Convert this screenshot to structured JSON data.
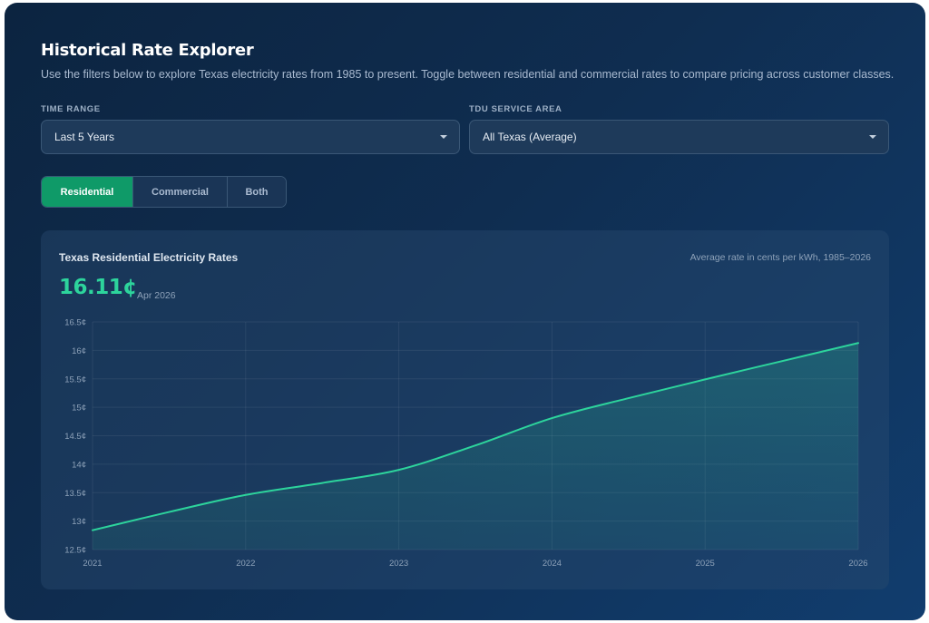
{
  "header": {
    "title": "Historical Rate Explorer",
    "description": "Use the filters below to explore Texas electricity rates from 1985 to present. Toggle between residential and commercial rates to compare pricing across customer classes."
  },
  "filters": {
    "time_range": {
      "label": "TIME RANGE",
      "value": "Last 5 Years"
    },
    "tdu_area": {
      "label": "TDU SERVICE AREA",
      "value": "All Texas (Average)"
    }
  },
  "toggles": [
    {
      "label": "Residential",
      "active": true
    },
    {
      "label": "Commercial",
      "active": false
    },
    {
      "label": "Both",
      "active": false
    }
  ],
  "chart": {
    "title": "Texas Residential Electricity Rates",
    "subtitle": "Average rate in cents per kWh, 1985–2026",
    "current_value": "16.11¢",
    "current_date": "Apr 2026"
  },
  "colors": {
    "accent": "#2dd49c",
    "active_toggle": "#0f9a68"
  },
  "chart_data": {
    "type": "area",
    "x": [
      2021,
      2021.5,
      2022,
      2022.5,
      2023,
      2023.5,
      2024,
      2024.5,
      2025,
      2025.5,
      2026
    ],
    "x_tick_labels": [
      "2021",
      "2022",
      "2023",
      "2024",
      "2025",
      "2026"
    ],
    "y_tick_values": [
      12.5,
      13,
      13.5,
      14,
      14.5,
      15,
      15.5,
      16,
      16.5
    ],
    "y_tick_labels": [
      "12.5¢",
      "13¢",
      "13.5¢",
      "14¢",
      "14.5¢",
      "15¢",
      "15.5¢",
      "16¢",
      "16.5¢"
    ],
    "series": [
      {
        "values": [
          12.84,
          13.16,
          13.46,
          13.67,
          13.9,
          14.33,
          14.81,
          15.16,
          15.49,
          15.81,
          16.13
        ]
      }
    ],
    "xlim": [
      2021,
      2026
    ],
    "ylim": [
      12.5,
      16.5
    ],
    "grid": true,
    "legend": "none"
  }
}
